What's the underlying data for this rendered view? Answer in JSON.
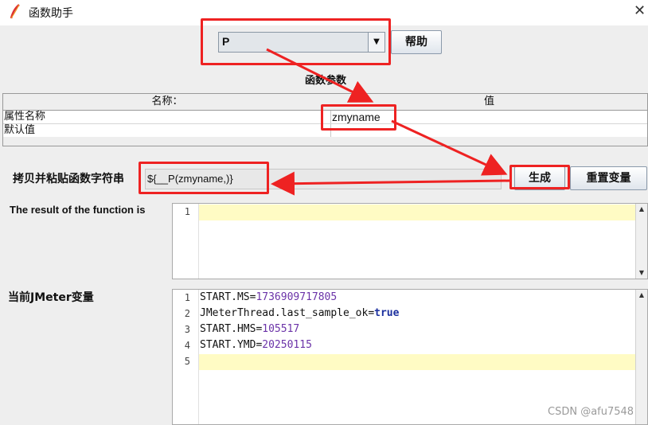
{
  "window": {
    "title": "函数助手",
    "close_glyph": "✕"
  },
  "function_select": {
    "value": "P",
    "arrow_glyph": "▼"
  },
  "help_button": {
    "label": "帮助"
  },
  "params": {
    "section_title": "函数参数",
    "columns": [
      "名称：",
      "值"
    ],
    "rows": [
      {
        "name": "属性名称",
        "value": "zmyname"
      },
      {
        "name": "默认值",
        "value": ""
      }
    ]
  },
  "copy": {
    "label": "拷贝并粘贴函数字符串",
    "value": "${__P(zmyname,)}"
  },
  "generate_button": {
    "label": "生成"
  },
  "reset_button": {
    "label": "重置变量"
  },
  "result": {
    "label": "The result of the function is",
    "lines": [
      "1"
    ]
  },
  "jmeter_vars": {
    "label": "当前JMeter变量",
    "lines": [
      {
        "num": "1",
        "key": "START.MS",
        "eq": "=",
        "val": "1736909717805"
      },
      {
        "num": "2",
        "key": "JMeterThread.last_sample_ok",
        "eq": "=",
        "val": "true"
      },
      {
        "num": "3",
        "key": "START.HMS",
        "eq": "=",
        "val": "105517"
      },
      {
        "num": "4",
        "key": "START.YMD",
        "eq": "=",
        "val": "20250115"
      },
      {
        "num": "5",
        "key": "",
        "eq": "",
        "val": ""
      }
    ]
  },
  "scroll": {
    "up": "▲",
    "down": "▼"
  },
  "watermark": "CSDN @afu7548",
  "colors": {
    "annotation": "#ee2222",
    "highlight": "#fffbc4"
  }
}
